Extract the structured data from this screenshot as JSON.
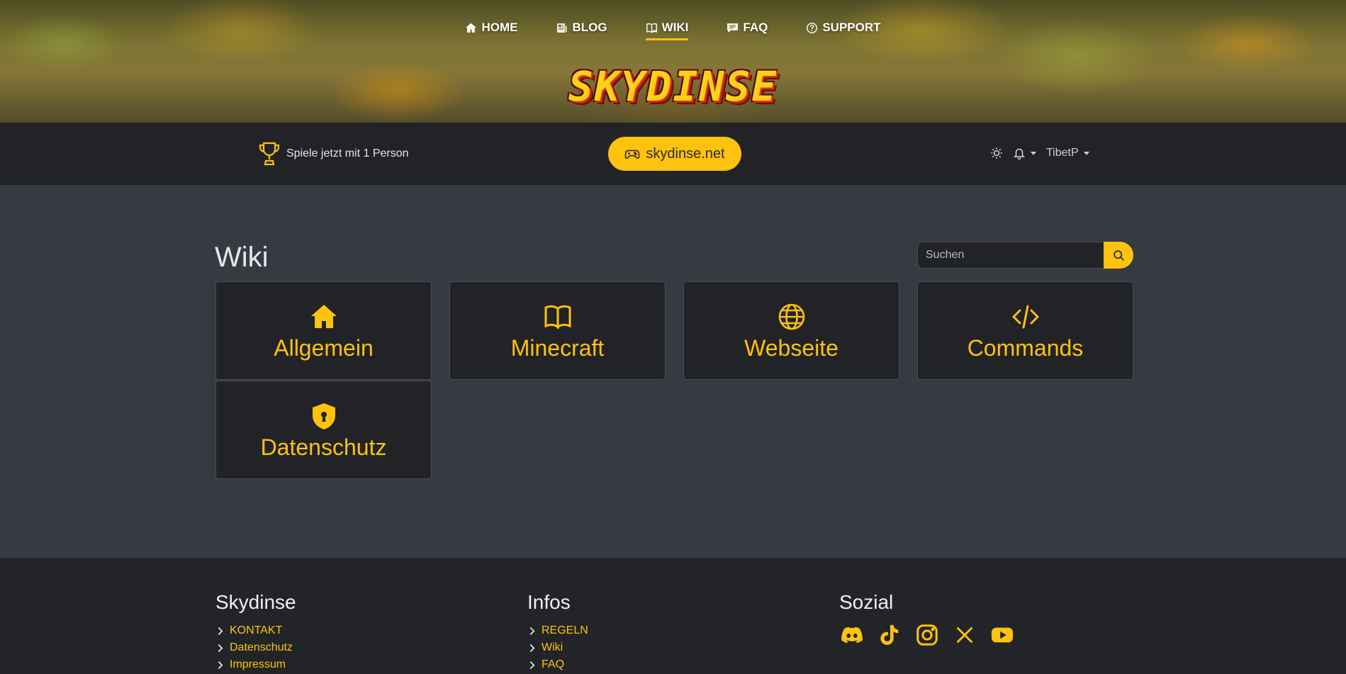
{
  "nav": {
    "items": [
      {
        "label": "HOME",
        "icon": "house-icon"
      },
      {
        "label": "BLOG",
        "icon": "newspaper-icon"
      },
      {
        "label": "WIKI",
        "icon": "book-icon",
        "active": true
      },
      {
        "label": "FAQ",
        "icon": "chat-icon"
      },
      {
        "label": "SUPPORT",
        "icon": "question-circle-icon"
      }
    ]
  },
  "logo": {
    "text": "SKYDINSE"
  },
  "status": {
    "players_text": "Spiele jetzt mit 1 Person",
    "server_ip": "skydinse.net",
    "username": "TibetP"
  },
  "main": {
    "title": "Wiki",
    "search_placeholder": "Suchen",
    "categories": [
      {
        "label": "Allgemein",
        "icon": "house-icon"
      },
      {
        "label": "Minecraft",
        "icon": "book-icon"
      },
      {
        "label": "Webseite",
        "icon": "globe-icon"
      },
      {
        "label": "Commands",
        "icon": "code-icon"
      },
      {
        "label": "Datenschutz",
        "icon": "shield-lock-icon"
      }
    ]
  },
  "footer": {
    "col1": {
      "title": "Skydinse",
      "links": [
        "KONTAKT",
        "Datenschutz",
        "Impressum"
      ]
    },
    "col2": {
      "title": "Infos",
      "links": [
        "REGELN",
        "Wiki",
        "FAQ"
      ]
    },
    "col3": {
      "title": "Sozial",
      "icons": [
        "discord-icon",
        "tiktok-icon",
        "instagram-icon",
        "x-icon",
        "youtube-icon"
      ]
    }
  },
  "colors": {
    "accent": "#ffc20e",
    "bar": "#212327",
    "page": "#363a42",
    "footer": "#222427"
  }
}
